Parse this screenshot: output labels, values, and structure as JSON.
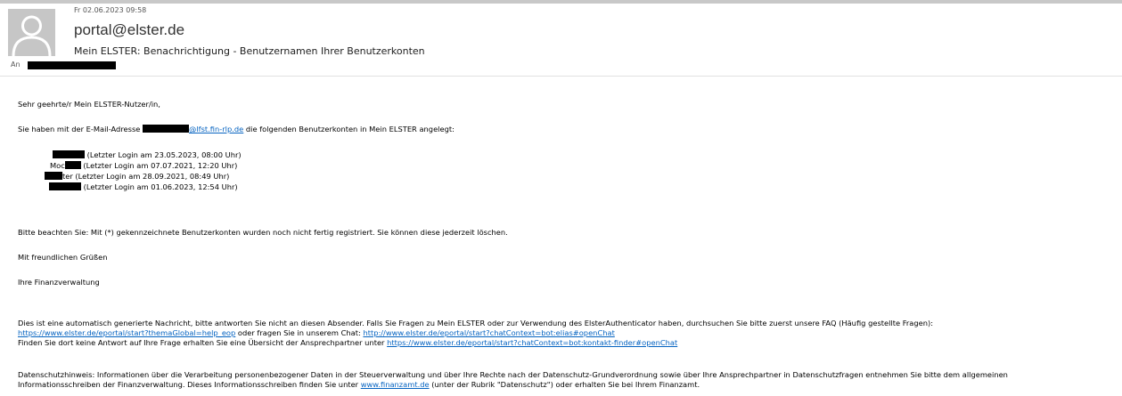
{
  "header": {
    "date": "Fr 02.06.2023 09:58",
    "from": "portal@elster.de",
    "subject": "Mein ELSTER: Benachrichtigung - Benutzernamen Ihrer Benutzerkonten",
    "to_label": "An"
  },
  "body": {
    "greeting": "Sehr geehrte/r Mein ELSTER-Nutzer/in,",
    "intro_before": "Sie haben mit der E-Mail-Adresse ",
    "intro_email_domain": "@lfst.fin-rlp.de",
    "intro_after": " die folgenden Benutzerkonten in Mein ELSTER angelegt:",
    "accounts": [
      {
        "prefix": "",
        "suffix": " (Letzter Login am 23.05.2023, 08:00 Uhr)"
      },
      {
        "prefix": "Moc",
        "suffix": " (Letzter Login am 07.07.2021, 12:20 Uhr)"
      },
      {
        "prefix": "",
        "suffix": "ter (Letzter Login am 28.09.2021, 08:49 Uhr)"
      },
      {
        "prefix": "",
        "suffix": " (Letzter Login am 01.06.2023, 12:54 Uhr)"
      }
    ],
    "note": "Bitte beachten Sie: Mit (*) gekennzeichnete Benutzerkonten wurden noch nicht fertig registriert. Sie können diese jederzeit löschen.",
    "closing": "Mit freundlichen Grüßen",
    "signature": "Ihre Finanzverwaltung",
    "auto_line1": "Dies ist eine automatisch generierte Nachricht, bitte antworten Sie nicht an diesen Absender. Falls Sie Fragen zu Mein ELSTER oder zur Verwendung des ElsterAuthenticator haben, durchsuchen Sie bitte zuerst unsere FAQ (Häufig gestellte Fragen):",
    "faq_link": "https://www.elster.de/eportal/start?themaGlobal=help_eop",
    "chat_text": " oder fragen Sie in unserem Chat: ",
    "chat_link": "http://www.elster.de/eportal/start?chatContext=bot:elias#openChat",
    "contact_text": "Finden Sie dort keine Antwort auf Ihre Frage erhalten Sie eine Übersicht der Ansprechpartner unter ",
    "contact_link": "https://www.elster.de/eportal/start?chatContext=bot:kontakt-finder#openChat",
    "privacy_line1": "Datenschutzhinweis: Informationen über die Verarbeitung personenbezogener Daten in der Steuerverwaltung und über Ihre Rechte nach der Datenschutz-Grundverordnung sowie über Ihre Ansprechpartner in Datenschutzfragen entnehmen Sie bitte dem allgemeinen",
    "privacy_line2_before": "Informationsschreiben der Finanzverwaltung. Dieses Informationsschreiben finden Sie unter ",
    "privacy_link": "www.finanzamt.de",
    "privacy_line2_after": " (unter der Rubrik \"Datenschutz\") oder erhalten Sie bei Ihrem Finanzamt."
  },
  "colors": {
    "link": "#0563c1",
    "avatar_bg": "#c6c6c6",
    "redaction": "#000000"
  }
}
